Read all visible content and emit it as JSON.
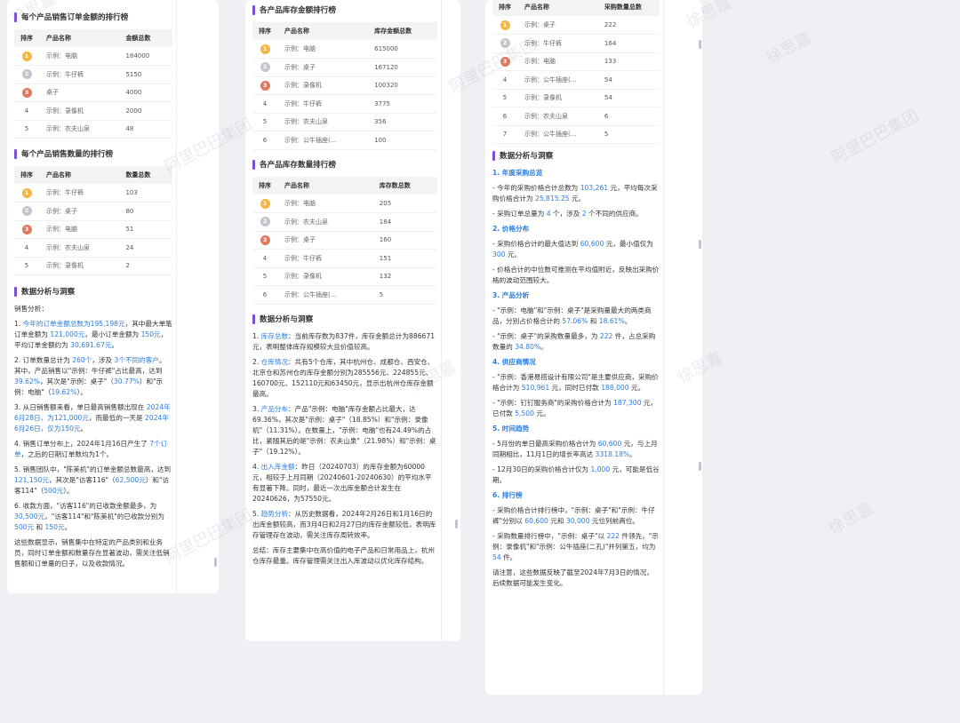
{
  "p1": {
    "t1": {
      "title": "每个产品销售订单金额的排行榜",
      "headers": [
        "排序",
        "产品名称",
        "金额总数"
      ],
      "rows": [
        [
          "1",
          "示例：电脑",
          "184000"
        ],
        [
          "2",
          "示例：牛仔裤",
          "5150"
        ],
        [
          "3",
          "桌子",
          "4000"
        ],
        [
          "4",
          "示例：录像机",
          "2000"
        ],
        [
          "5",
          "示例：农夫山泉",
          "48"
        ]
      ]
    },
    "t2": {
      "title": "每个产品销售数量的排行榜",
      "headers": [
        "排序",
        "产品名称",
        "数量总数"
      ],
      "rows": [
        [
          "1",
          "示例：牛仔裤",
          "103"
        ],
        [
          "2",
          "示例：桌子",
          "80"
        ],
        [
          "3",
          "示例：电脑",
          "51"
        ],
        [
          "4",
          "示例：农夫山泉",
          "24"
        ],
        [
          "5",
          "示例：录像机",
          "2"
        ]
      ]
    },
    "analysis_title": "数据分析与洞察",
    "intro": "销售分析：",
    "items": [
      [
        "1. ",
        {
          "h": "今年的订单金额总数为195,198元"
        },
        "，其中最大单笔订单金额为 ",
        {
          "h": "121,000元"
        },
        "，最小订单金额为 ",
        {
          "h": "150元"
        },
        "，平均订单金额约为 ",
        {
          "h": "30,691.67元"
        },
        "。"
      ],
      [
        "2. 订单数量总计为 ",
        {
          "h": "260个"
        },
        "，涉及 ",
        {
          "h": "3个不同的客户"
        },
        "。其中，产品销售以\"示例：牛仔裤\"占比最高，达到 ",
        {
          "h": "39.62%"
        },
        "，其次是\"示例：桌子\"（",
        {
          "h": "30.77%"
        },
        "）和\"示例：电脑\"（",
        {
          "h": "19.62%"
        },
        "）。"
      ],
      [
        "3. 从日销售额来看，单日最高销售额出现在 ",
        {
          "h": "2024年6月28日，为121,000元"
        },
        "，而最低的一天是 ",
        {
          "h": "2024年6月26日，仅为150元"
        },
        "。"
      ],
      [
        "4. 销售订单分布上，2024年1月16日产生了 ",
        {
          "h": "7个订单"
        },
        "，之后的日期订单数均为1个。"
      ],
      [
        "5. 销售团队中，\"陈美机\"的订单金额总数最高，达到 ",
        {
          "h": "121,150元"
        },
        "，其次是\"访客116\"（",
        {
          "h": "62,500元"
        },
        "）和\"访客114\"（",
        {
          "h": "500元"
        },
        "）。"
      ],
      [
        "6. 收款方面，\"访客116\"的已收款金额最多，为 ",
        {
          "h": "30,500元"
        },
        "，\"访客114\"和\"陈美机\"的已收款分别为 ",
        {
          "h": "500元"
        },
        " 和 ",
        {
          "h": "150元"
        },
        "。"
      ],
      [
        "这些数据显示，销售集中在特定的产品类别和业务员，同时订单金额和数量存在显著波动，需关注低销售额和订单量的日子，以及收款情况。"
      ]
    ]
  },
  "p2": {
    "t1": {
      "title": "各产品库存金额排行榜",
      "headers": [
        "排序",
        "产品名称",
        "库存金额总数"
      ],
      "rows": [
        [
          "1",
          "示例：电脑",
          "615000"
        ],
        [
          "2",
          "示例：桌子",
          "167120"
        ],
        [
          "3",
          "示例：录像机",
          "100320"
        ],
        [
          "4",
          "示例：牛仔裤",
          "3775"
        ],
        [
          "5",
          "示例：农夫山泉",
          "356"
        ],
        [
          "6",
          "示例：公牛插座(...",
          "100"
        ]
      ]
    },
    "t2": {
      "title": "各产品库存数量排行榜",
      "headers": [
        "排序",
        "产品名称",
        "库存数总数"
      ],
      "rows": [
        [
          "1",
          "示例：电脑",
          "205"
        ],
        [
          "2",
          "示例：农夫山泉",
          "184"
        ],
        [
          "3",
          "示例：桌子",
          "160"
        ],
        [
          "4",
          "示例：牛仔裤",
          "151"
        ],
        [
          "5",
          "示例：录像机",
          "132"
        ],
        [
          "6",
          "示例：公牛插座(...",
          "5"
        ]
      ]
    },
    "analysis_title": "数据分析与洞察",
    "items": [
      [
        "1. ",
        {
          "h": "库存总数"
        },
        "：当前库存数为837件，库存金额总计为886671元，表明整体库存规模较大且价值较高。"
      ],
      [
        "2. ",
        {
          "h": "仓库情况"
        },
        "：共有5个仓库，其中杭州仓、成都仓、西安仓、北京仓和苏州仓的库存金额分别为285556元、224855元、160700元、152110元和63450元，显示出杭州仓库存金额最高。"
      ],
      [
        "3. ",
        {
          "h": "产品分布"
        },
        "：产品\"示例：电脑\"库存金额占比最大，达69.36%，其次是\"示例：桌子\"（18.85%）和\"示例：录像机\"（11.31%）。在数量上，\"示例：电脑\"也有24.49%的占比，紧随其后的是\"示例：农夫山泉\"（21.98%）和\"示例：桌子\"（19.12%）。"
      ],
      [
        "4. ",
        {
          "h": "出入库金额"
        },
        "：昨日（20240703）的库存金额为60000元，相较于上月同期（20240601-20240630）的平均水平有显著下降。同时，最近一次出库金额合计发生在20240626，为57550元。"
      ],
      [
        "5. ",
        {
          "h": "趋势分析"
        },
        "：从历史数据看，2024年2月26日和1月16日的出库金额较高，而3月4日和2月27日的库存金额较低，表明库存管理存在波动，需关注库存周转效率。"
      ],
      [
        "总结：库存主要集中在高价值的电子产品和日常用品上，杭州仓库存最重。库存管理需关注出入库波动以优化库存结构。"
      ]
    ]
  },
  "p3": {
    "t1": {
      "headers": [
        "排序",
        "产品名称",
        "采购数量总数"
      ],
      "rows": [
        [
          "1",
          "示例：桌子",
          "222"
        ],
        [
          "2",
          "示例：牛仔裤",
          "164"
        ],
        [
          "3",
          "示例：电脑",
          "133"
        ],
        [
          "4",
          "示例：公牛插座(...",
          "54"
        ],
        [
          "5",
          "示例：录像机",
          "54"
        ],
        [
          "6",
          "示例：农夫山泉",
          "6"
        ],
        [
          "7",
          "示例：公牛插座(...",
          "5"
        ]
      ]
    },
    "analysis_title": "数据分析与洞察",
    "blocks": [
      {
        "sub": "1. 年度采购总览",
        "paras": [
          [
            "- 今年的采购价格合计总数为 ",
            {
              "h": "103,261"
            },
            " 元，平均每次采购价格合计为 ",
            {
              "h": "25,815.25"
            },
            " 元。"
          ],
          [
            "- 采购订单总量为 ",
            {
              "h": "4"
            },
            " 个，涉及 ",
            {
              "h": "2"
            },
            " 个不同的供应商。"
          ]
        ]
      },
      {
        "sub": "2. 价格分布",
        "paras": [
          [
            "- 采购价格合计的最大值达到 ",
            {
              "h": "60,600"
            },
            " 元，最小值仅为 ",
            {
              "h": "300"
            },
            " 元。"
          ],
          [
            "- 价格合计的中位数可推测在平均值附近，反映出采购价格的波动范围较大。"
          ]
        ]
      },
      {
        "sub": "3. 产品分析",
        "paras": [
          [
            "- \"示例：电脑\"和\"示例：桌子\"是采购量最大的两类商品，分别占价格合计的 ",
            {
              "h": "57.06%"
            },
            " 和 ",
            {
              "h": "18.61%"
            },
            "。"
          ],
          [
            "- \"示例：桌子\"的采购数量最多，为 ",
            {
              "h": "222"
            },
            " 件，占总采购数量的 ",
            {
              "h": "34.80%"
            },
            "。"
          ]
        ]
      },
      {
        "sub": "4. 供应商情况",
        "paras": [
          [
            "- \"示例：香港易搭设计有限公司\"是主要供应商，采购价格合计为 ",
            {
              "h": "510,961"
            },
            " 元，同时已付款 ",
            {
              "h": "188,000"
            },
            " 元。"
          ],
          [
            "- \"示例：钉钉服务商\"的采购价格合计为 ",
            {
              "h": "187,300"
            },
            " 元，已付款 ",
            {
              "h": "5,500"
            },
            " 元。"
          ]
        ]
      },
      {
        "sub": "5. 时间趋势",
        "paras": [
          [
            "- 5月份的单日最高采购价格合计为 ",
            {
              "h": "60,600"
            },
            " 元，与上月同期相比，11月1日的增长率高达 ",
            {
              "h": "3318.18%"
            },
            "。"
          ],
          [
            "- 12月30日的采购价格合计仅为 ",
            {
              "h": "1,000"
            },
            " 元，可能是低谷期。"
          ]
        ]
      },
      {
        "sub": "6. 排行榜",
        "paras": [
          [
            "- 采购价格合计排行榜中，\"示例：桌子\"和\"示例：牛仔裤\"分别以 ",
            {
              "h": "60,600"
            },
            " 元和 ",
            {
              "h": "30,000"
            },
            " 元位列前两位。"
          ],
          [
            "- 采购数量排行榜中，\"示例：桌子\"以 ",
            {
              "h": "222"
            },
            " 件领先，\"示例：录像机\"和\"示例：公牛插座(二孔)\"并列第五，均为 ",
            {
              "h": "54"
            },
            " 件。"
          ],
          [
            "请注意，这些数据反映了截至2024年7月3日的情况，后续数据可能发生变化。"
          ]
        ]
      }
    ]
  },
  "watermarks": [
    "徐思嘉",
    "阿里巴巴集团",
    "徐思嘉",
    "阿里巴巴集团",
    "徐思嘉",
    "阿里巴巴集团",
    "徐思嘉",
    "阿里巴巴集团",
    "徐思嘉",
    "徐思嘉"
  ]
}
